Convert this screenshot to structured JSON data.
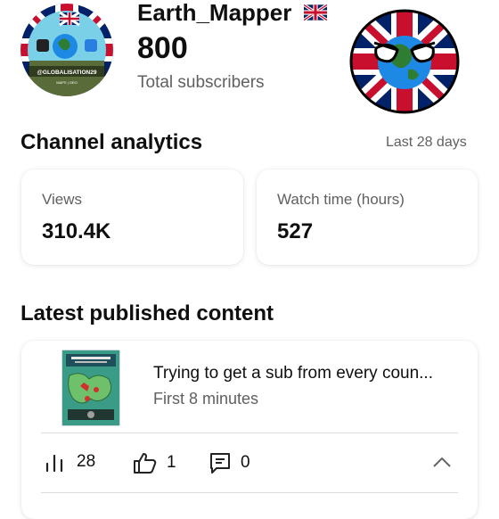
{
  "header": {
    "channel_name": "Earth_Mapper",
    "subscriber_count": "800",
    "subscriber_label": "Total subscribers",
    "avatar_caption": "@GLOBALISATION29",
    "avatar_caption_small": "MAPS | GEO"
  },
  "analytics": {
    "title": "Channel analytics",
    "period": "Last 28 days",
    "views_label": "Views",
    "views_value": "310.4K",
    "watch_label": "Watch time (hours)",
    "watch_value": "527"
  },
  "latest": {
    "title": "Latest published content",
    "video_title": "Trying to get a sub from every coun...",
    "video_subtitle": "First 8 minutes",
    "views": "28",
    "likes": "1",
    "comments": "0"
  },
  "icons": {
    "flag": "uk-flag-icon",
    "views": "bar-chart-icon",
    "likes": "thumbs-up-icon",
    "comments": "comment-icon",
    "collapse": "chevron-up-icon"
  },
  "colors": {
    "flag_blue": "#012169",
    "flag_red": "#C8102E",
    "globe_green": "#2e7d32",
    "globe_blue": "#1e88e5"
  }
}
